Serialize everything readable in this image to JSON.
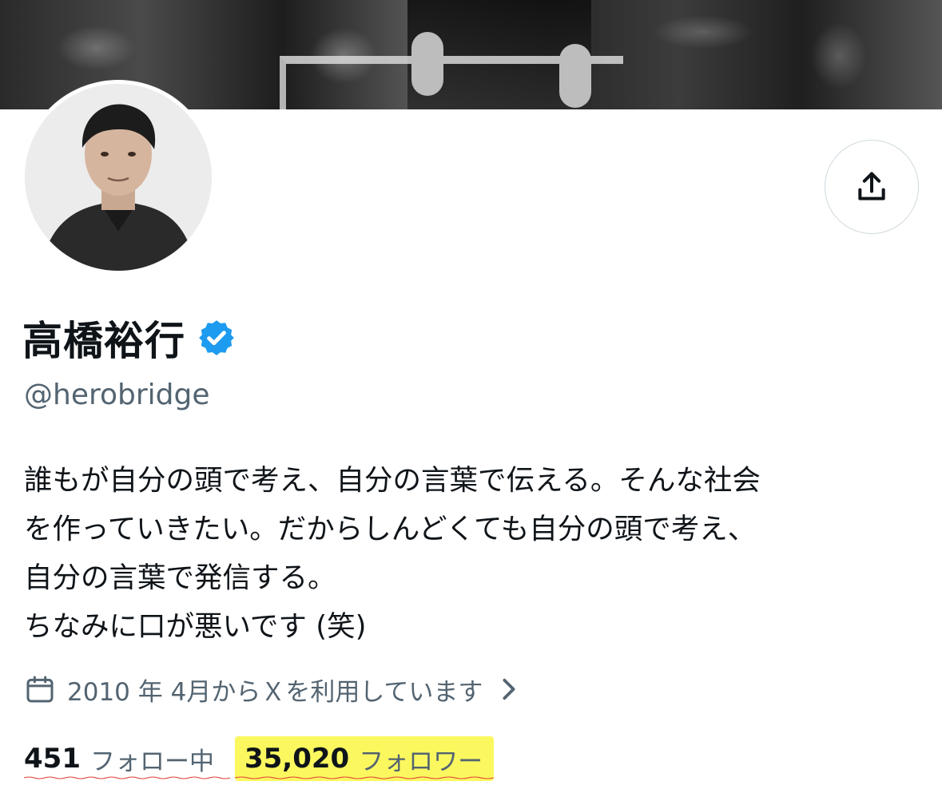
{
  "profile": {
    "display_name": "高橋裕行",
    "handle": "@herobridge",
    "verified_icon": "verified-badge-icon",
    "bio_lines": [
      "誰もが自分の頭で考え、自分の言葉で伝える。そんな社会",
      "を作っていきたい。だからしんどくても自分の頭で考え、",
      "自分の言葉で発信する。",
      "ちなみに口が悪いです (笑)"
    ],
    "joined": "2010 年 4月からＸを利用しています",
    "following_count": "451",
    "following_label": "フォロー中",
    "followers_count": "35,020",
    "followers_label": "フォロワー"
  },
  "icons": {
    "share": "share-icon",
    "calendar": "calendar-icon",
    "chevron": "chevron-right-icon"
  },
  "colors": {
    "verified_blue": "#1d9bf0",
    "text_primary": "#0f1419",
    "text_secondary": "#536471",
    "highlight": "#fbf85f",
    "underline_red": "#e0443a"
  }
}
